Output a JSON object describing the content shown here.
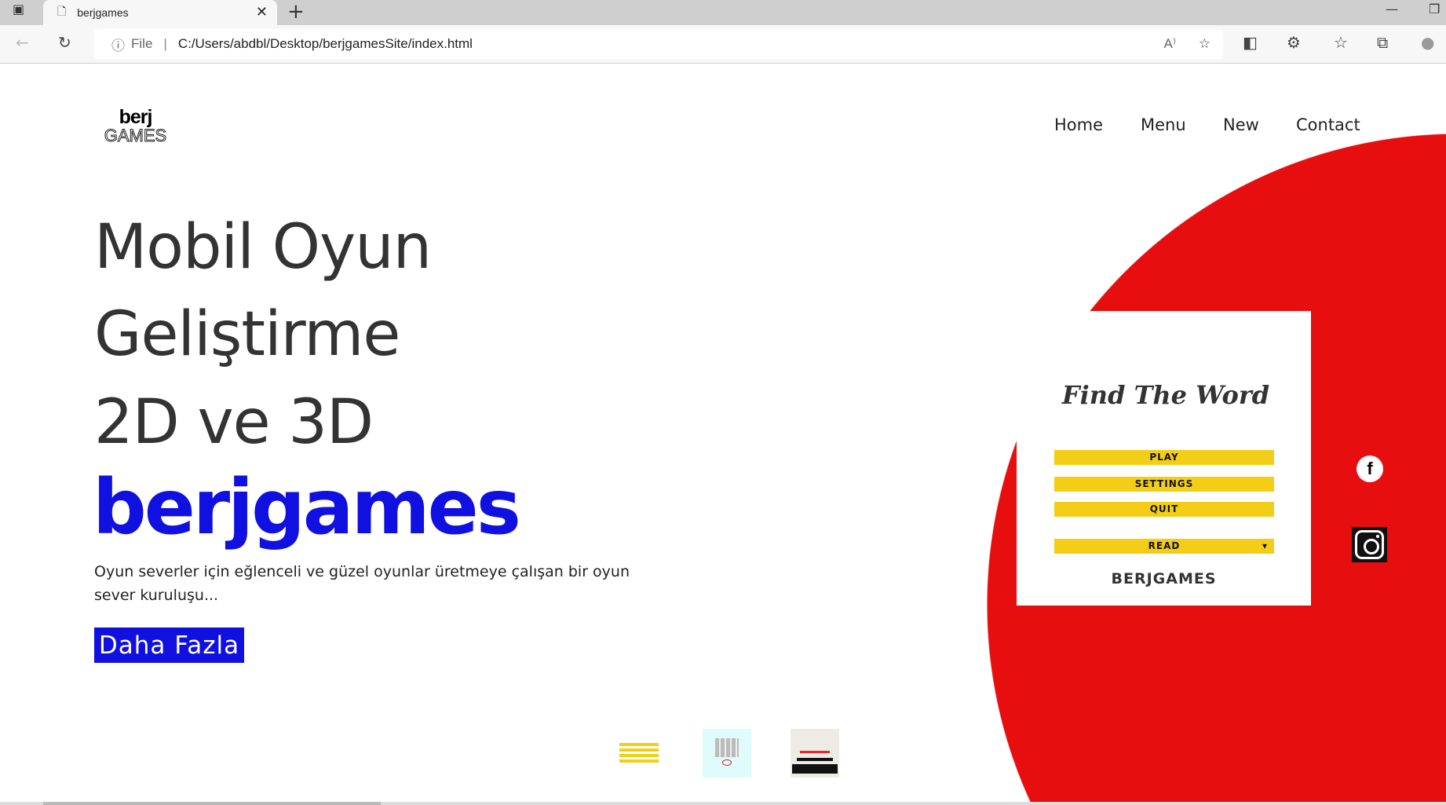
{
  "browser": {
    "tab_title": "berjgames",
    "url_prefix": "File",
    "url": "C:/Users/abdbl/Desktop/berjgamesSite/index.html"
  },
  "logo": {
    "top": "berj",
    "bottom": "GAMES"
  },
  "nav": [
    "Home",
    "Menu",
    "New",
    "Contact"
  ],
  "hero": {
    "line1": "Mobil Oyun",
    "line2": "Geliştirme",
    "line3": "2D ve 3D",
    "brand": "berjgames",
    "description": "Oyun severler için eğlenceli ve güzel oyunlar üretmeye çalışan bir oyun sever kuruluşu...",
    "button": "Daha Fazla"
  },
  "game_card": {
    "title": "Find The Word",
    "buttons": [
      "PLAY",
      "SETTINGS",
      "QUIT",
      "READ"
    ],
    "brand": "BERJGAMES"
  },
  "social": {
    "facebook": "f"
  },
  "colors": {
    "accent": "#1010e0",
    "red": "#e60e0e",
    "yellow": "#f4ce16"
  }
}
